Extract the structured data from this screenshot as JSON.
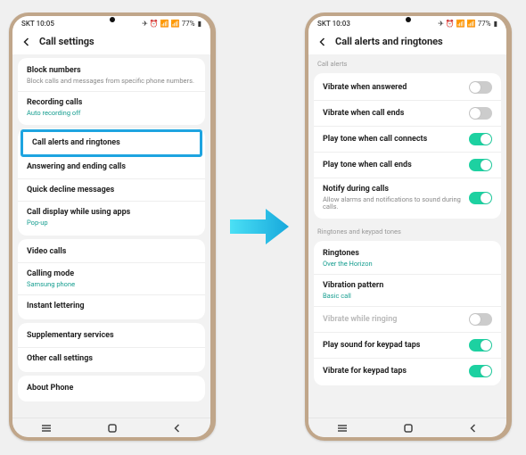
{
  "status": {
    "left_time_a": "SKT 10:05",
    "left_time_b": "SKT 10:03",
    "right_icons": "✈ ⏰ 📶 📶 77%",
    "battery_icon": "▮"
  },
  "phone_a": {
    "title": "Call settings",
    "groups": [
      {
        "rows": [
          {
            "title": "Block numbers",
            "sub": "Block calls and messages from specific phone numbers.",
            "subClass": ""
          },
          {
            "title": "Recording calls",
            "sub": "Auto recording off",
            "subClass": "teal"
          }
        ]
      },
      {
        "rows": [
          {
            "title": "Call alerts and ringtones",
            "highlight": true
          },
          {
            "title": "Answering and ending calls"
          },
          {
            "title": "Quick decline messages"
          },
          {
            "title": "Call display while using apps",
            "sub": "Pop-up",
            "subClass": "teal"
          }
        ]
      },
      {
        "rows": [
          {
            "title": "Video calls"
          },
          {
            "title": "Calling mode",
            "sub": "Samsung phone",
            "subClass": "teal"
          },
          {
            "title": "Instant lettering"
          }
        ]
      },
      {
        "rows": [
          {
            "title": "Supplementary services"
          },
          {
            "title": "Other call settings"
          }
        ]
      },
      {
        "rows": [
          {
            "title": "About Phone"
          }
        ]
      }
    ]
  },
  "phone_b": {
    "title": "Call alerts and ringtones",
    "section1_label": "Call alerts",
    "section1_rows": [
      {
        "title": "Vibrate when answered",
        "toggle": "off"
      },
      {
        "title": "Vibrate when call ends",
        "toggle": "off"
      },
      {
        "title": "Play tone when call connects",
        "toggle": "on"
      },
      {
        "title": "Play tone when call ends",
        "toggle": "on"
      },
      {
        "title": "Notify during calls",
        "sub": "Allow alarms and notifications to sound during calls.",
        "toggle": "on"
      }
    ],
    "section2_label": "Ringtones and keypad tones",
    "section2_rows": [
      {
        "title": "Ringtones",
        "sub": "Over the Horizon",
        "subClass": "teal"
      },
      {
        "title": "Vibration pattern",
        "sub": "Basic call",
        "subClass": "teal"
      },
      {
        "title": "Vibrate while ringing",
        "toggle": "off",
        "disabled": true
      },
      {
        "title": "Play sound for keypad taps",
        "toggle": "on"
      },
      {
        "title": "Vibrate for keypad taps",
        "toggle": "on"
      }
    ]
  }
}
